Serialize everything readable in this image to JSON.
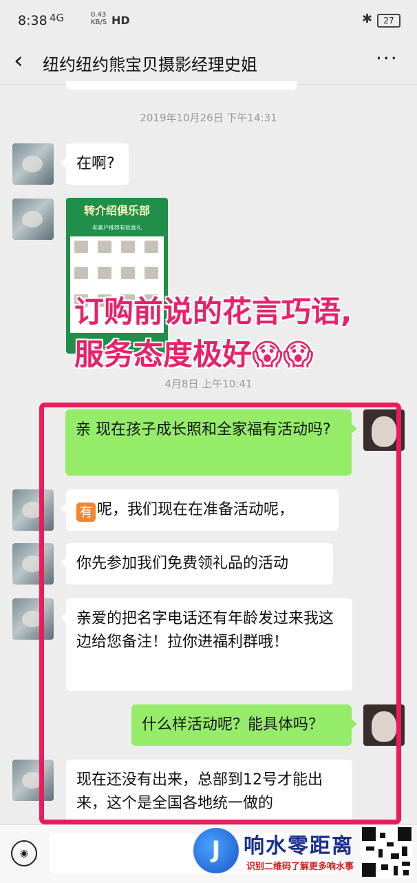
{
  "status_bar": {
    "time": "8:38",
    "signal": "4G",
    "net_speed": "0.43\nKB/S",
    "hd": "HD",
    "battery": "27"
  },
  "header": {
    "title": "纽约纽约熊宝贝摄影经理史姐"
  },
  "timestamps": [
    "2019年10月26日 下午14:31",
    "4月8日 上午10:41"
  ],
  "image_card": {
    "title": "转介绍俱乐部",
    "subtitle": "老客户推荐有惊喜礼"
  },
  "overlay": {
    "line1": "订购前说的花言巧语,",
    "line2": "服务态度极好😱😱"
  },
  "messages": {
    "m1": "在啊?",
    "m2": "亲 现在孩子成长照和全家福有活动吗?",
    "m3_badge": "有",
    "m3": "呢，我们现在在准备活动呢，",
    "m4": "你先参加我们免费领礼品的活动",
    "m5": "亲爱的把名字电话还有年龄发过来我这边给您备注！拉你进福利群哦！",
    "m6": "什么样活动呢？能具体吗？",
    "m7": "现在还没有出来，总部到12号才能出来，这个是全国各地统一做的"
  },
  "watermark": {
    "logo": "J",
    "name": "响水零距离",
    "tagline": "识别二维码了解更多响水事"
  },
  "colors": {
    "accent_frame": "#ec1b5c",
    "sent_bubble": "#95ec69",
    "overlay_text": "#e8226a"
  }
}
